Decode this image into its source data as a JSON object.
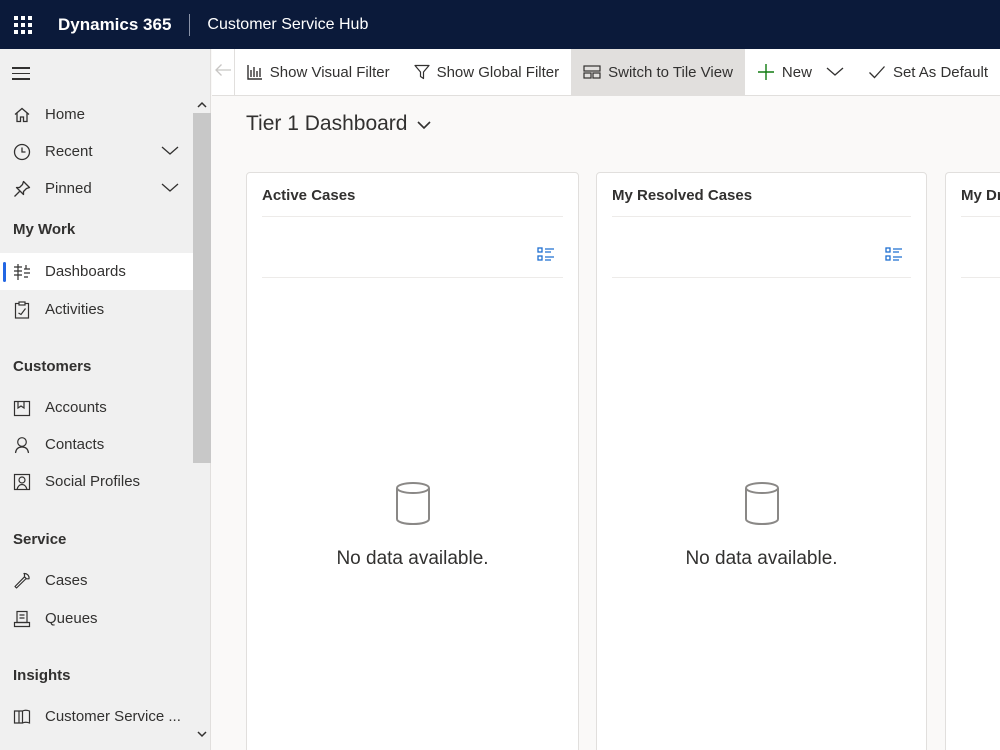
{
  "header": {
    "brand": "Dynamics 365",
    "app_name": "Customer Service Hub"
  },
  "sidebar": {
    "items": [
      {
        "label": "Home"
      },
      {
        "label": "Recent"
      },
      {
        "label": "Pinned"
      }
    ],
    "groups": {
      "my_work": {
        "title": "My Work",
        "items": [
          {
            "label": "Dashboards"
          },
          {
            "label": "Activities"
          }
        ]
      },
      "customers": {
        "title": "Customers",
        "items": [
          {
            "label": "Accounts"
          },
          {
            "label": "Contacts"
          },
          {
            "label": "Social Profiles"
          }
        ]
      },
      "service": {
        "title": "Service",
        "items": [
          {
            "label": "Cases"
          },
          {
            "label": "Queues"
          }
        ]
      },
      "insights": {
        "title": "Insights",
        "items": [
          {
            "label": "Customer Service ..."
          }
        ]
      }
    }
  },
  "commandbar": {
    "show_visual_filter": "Show Visual Filter",
    "show_global_filter": "Show Global Filter",
    "switch_to_tile_view": "Switch to Tile View",
    "new": "New",
    "set_as_default": "Set As Default"
  },
  "dashboard": {
    "title": "Tier 1 Dashboard",
    "cards": [
      {
        "title": "Active Cases",
        "empty_text": "No data available."
      },
      {
        "title": "My Resolved Cases",
        "empty_text": "No data available."
      },
      {
        "title": "My Drafts"
      }
    ]
  },
  "colors": {
    "topbar": "#0b1a3a",
    "accent": "#2266e3",
    "list_icon": "#1f6fd1"
  }
}
